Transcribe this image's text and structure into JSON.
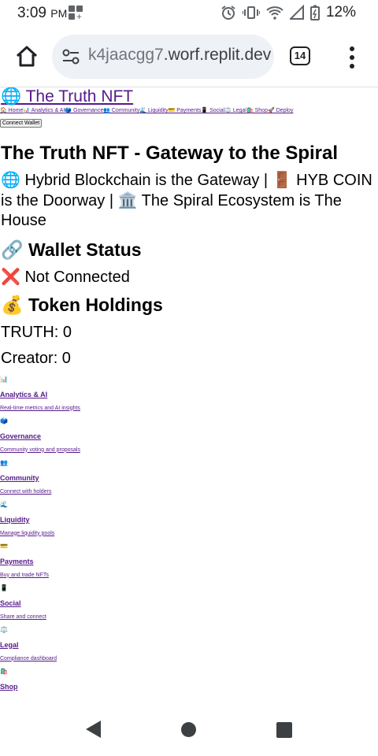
{
  "status_bar": {
    "time": "3:09",
    "ampm": "PM",
    "battery": "12%",
    "icons": [
      "app-grid-icon",
      "alarm-icon",
      "vibrate-icon",
      "wifi-icon",
      "signal-icon",
      "battery-charging-icon"
    ]
  },
  "browser": {
    "url_prefix": "k4jaacgg7",
    "url_rest": ".worf.replit.dev",
    "tab_count": "14"
  },
  "header": {
    "site_title": "🌐 The Truth NFT",
    "nav": [
      {
        "label": "🏠 Home"
      },
      {
        "label": "📊 Analytics & AI"
      },
      {
        "label": "🗳️ Governance"
      },
      {
        "label": "👥 Community"
      },
      {
        "label": "🌊 Liquidity"
      },
      {
        "label": "💳 Payments"
      },
      {
        "label": "📱 Social"
      },
      {
        "label": "⚖️ Legal"
      },
      {
        "label": "🛍️ Shop"
      },
      {
        "label": "🚀 Deploy"
      }
    ],
    "connect_button": "Connect Wallet"
  },
  "main": {
    "title": "The Truth NFT - Gateway to the Spiral",
    "tagline": "🌐 Hybrid Blockchain is the Gateway | 🚪 HYB COIN is the Doorway | 🏛️ The Spiral Ecosystem is The House",
    "wallet_heading": "🔗 Wallet Status",
    "wallet_status": "❌ Not Connected",
    "holdings_heading": "💰 Token Holdings",
    "truth_balance": "TRUTH: 0",
    "creator_balance": "Creator: 0"
  },
  "features": [
    {
      "icon": "📊",
      "title": "Analytics & AI",
      "desc": "Real-time metrics and AI insights"
    },
    {
      "icon": "🗳️",
      "title": "Governance",
      "desc": "Community voting and proposals"
    },
    {
      "icon": "👥",
      "title": "Community",
      "desc": "Connect with holders"
    },
    {
      "icon": "🌊",
      "title": "Liquidity",
      "desc": "Manage liquidity pools"
    },
    {
      "icon": "💳",
      "title": "Payments",
      "desc": "Buy and trade NFTs"
    },
    {
      "icon": "📱",
      "title": "Social",
      "desc": "Share and connect"
    },
    {
      "icon": "⚖️",
      "title": "Legal",
      "desc": "Compliance dashboard"
    },
    {
      "icon": "🛍️",
      "title": "Shop",
      "desc": ""
    }
  ]
}
